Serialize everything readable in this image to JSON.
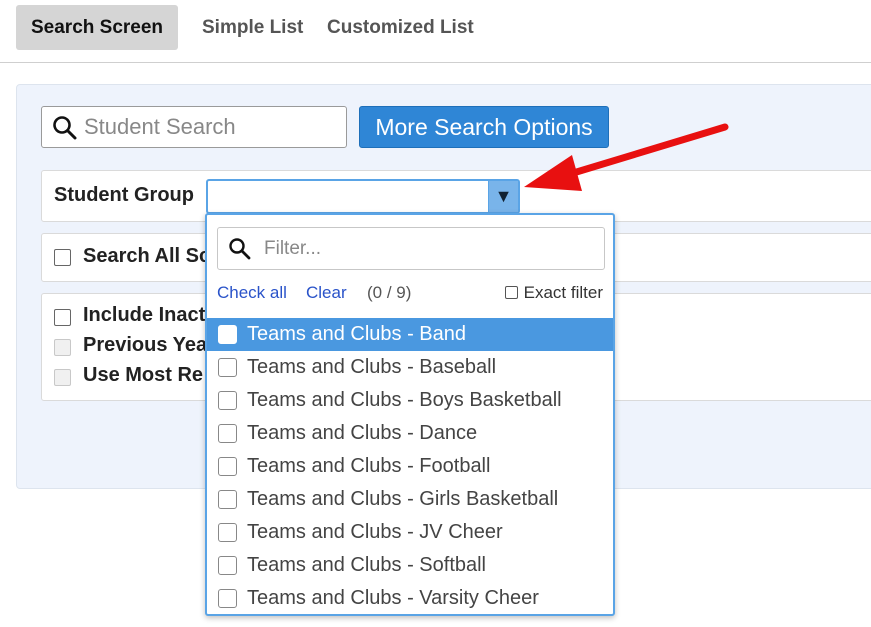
{
  "tabs": [
    {
      "label": "Search Screen",
      "active": true
    },
    {
      "label": "Simple List",
      "active": false
    },
    {
      "label": "Customized List",
      "active": false
    }
  ],
  "search": {
    "placeholder": "Student Search",
    "value": ""
  },
  "more_options_label": "More Search Options",
  "student_group": {
    "label": "Student Group",
    "value": "",
    "caret": "▼"
  },
  "search_all_label": "Search All Sc",
  "options": [
    {
      "label": "Include Inact",
      "enabled": true
    },
    {
      "label": "Previous Yea",
      "enabled": false
    },
    {
      "label": "Use Most Re",
      "enabled": false
    }
  ],
  "dropdown": {
    "filter_placeholder": "Filter...",
    "check_all": "Check all",
    "clear": "Clear",
    "count": "(0 / 9)",
    "exact_filter": "Exact filter",
    "items": [
      "Teams and Clubs - Band",
      "Teams and Clubs - Baseball",
      "Teams and Clubs - Boys Basketball",
      "Teams and Clubs - Dance",
      "Teams and Clubs - Football",
      "Teams and Clubs - Girls Basketball",
      "Teams and Clubs - JV Cheer",
      "Teams and Clubs - Softball",
      "Teams and Clubs - Varsity Cheer"
    ],
    "highlighted_index": 0
  },
  "colors": {
    "accent": "#2f86d6",
    "highlight": "#4a98e0",
    "arrow": "#e81010"
  },
  "icons": {
    "search": "search-icon",
    "filter": "search-icon",
    "caret": "caret-down-icon",
    "arrow": "red-arrow-icon"
  }
}
